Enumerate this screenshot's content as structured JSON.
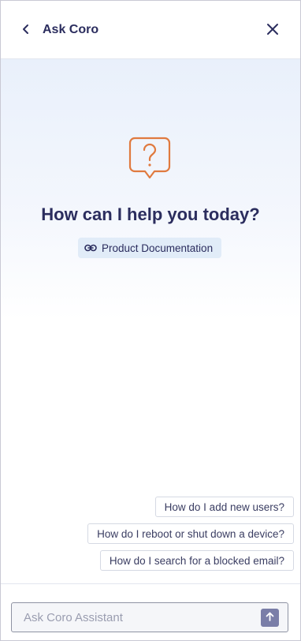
{
  "header": {
    "title": "Ask Coro",
    "back_icon": "chevron-left-icon",
    "close_icon": "close-icon"
  },
  "hero": {
    "icon": "question-bubble-icon",
    "heading": "How can I help you today?",
    "doc_link_icon": "link-icon",
    "doc_link_label": "Product Documentation"
  },
  "suggestions": [
    "How do I add new users?",
    "How do I reboot or shut down a device?",
    "How do I search for a blocked email?"
  ],
  "input": {
    "placeholder": "Ask Coro Assistant",
    "value": "",
    "send_icon": "arrow-up-icon"
  },
  "colors": {
    "primary_text": "#2b2d5e",
    "accent_orange": "#e07a3f",
    "doc_link_bg": "#e1ecf8",
    "send_button": "#7a7ea8"
  }
}
